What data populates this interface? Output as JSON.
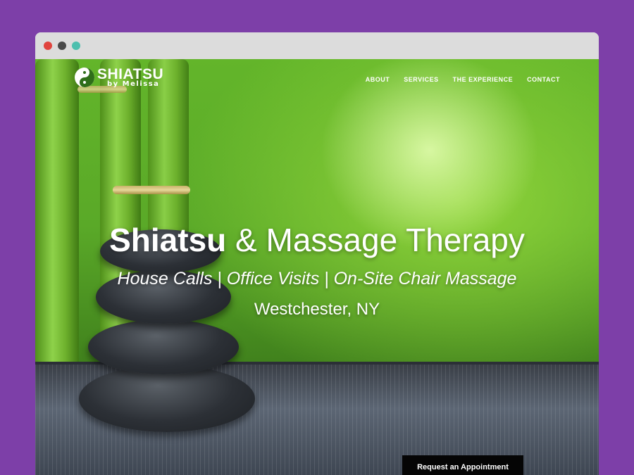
{
  "window": {
    "controls": [
      {
        "name": "close",
        "color": "#e0443e"
      },
      {
        "name": "minimize",
        "color": "#4a4a4a"
      },
      {
        "name": "maximize",
        "color": "#4dbfae"
      }
    ]
  },
  "header": {
    "logo_title": "SHIATSU",
    "logo_subtitle": "by Melissa",
    "nav": [
      "ABOUT",
      "SERVICES",
      "THE EXPERIENCE",
      "CONTACT"
    ]
  },
  "hero": {
    "title_bold": "Shiatsu",
    "title_rest": " & Massage Therapy",
    "subtitle": "House Calls | Office Visits | On-Site Chair Massage",
    "location": "Westchester, NY",
    "cta_label": "Request an Appointment"
  },
  "colors": {
    "page_background": "#7d3fa8",
    "accent_green": "#63b52a",
    "cta_background": "#050505"
  }
}
